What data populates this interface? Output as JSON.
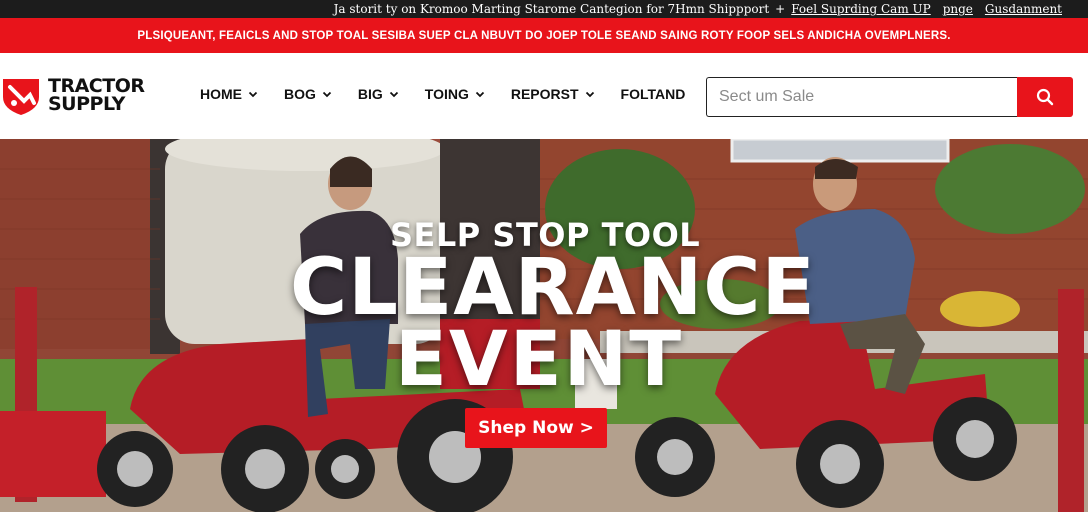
{
  "topbar": {
    "text": "Ja storit ty on Kromoo Marting Starome Cantegion for 7Hmn Shippport",
    "link1": "Foel Suprding Cam UP",
    "link2": "pnge",
    "link3": "Gusdanment"
  },
  "promo": {
    "text": "PLSIQUEANT, FEAICLS AND STOP TOAL SESIBA SUEP CLA NBUVT DO JOEP TOLE SEAND SAING ROTY FOOP SELS ANDICHA OVEMPLNERS."
  },
  "logo": {
    "line1": "TRACTOR",
    "line2": "SUPPLY",
    "brand_color": "#e8141b"
  },
  "nav": {
    "items": [
      {
        "label": "HOME",
        "has_dropdown": true
      },
      {
        "label": "BOG",
        "has_dropdown": true
      },
      {
        "label": "BIG",
        "has_dropdown": true
      },
      {
        "label": "TOING",
        "has_dropdown": true
      },
      {
        "label": "REPORST",
        "has_dropdown": true
      },
      {
        "label": "FOLTAND",
        "has_dropdown": false
      }
    ]
  },
  "search": {
    "placeholder": "Sect um Sale",
    "icon": "search-icon"
  },
  "hero": {
    "kicker": "SELP STOP TOOL",
    "title_line1": "CLEARANCE",
    "title_line2": "EVENT",
    "cta_label": "Shep Now >"
  },
  "colors": {
    "accent": "#e8141b",
    "topbar_bg": "#1c1c1c"
  }
}
